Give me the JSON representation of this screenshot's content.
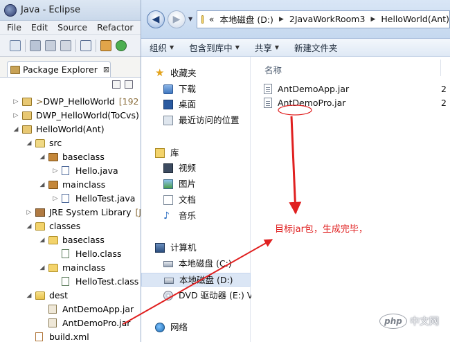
{
  "eclipse": {
    "title": "Java - Eclipse",
    "menu": [
      "File",
      "Edit",
      "Source",
      "Refactor"
    ],
    "view_tab": {
      "label": "Package Explorer",
      "close": "⊠"
    },
    "tree": [
      {
        "label": "DWP_HelloWorld",
        "prefix": ">",
        "suffix": "[192",
        "icon": "project",
        "twisty": "▷",
        "depth": 0
      },
      {
        "label": "DWP_HelloWorld(ToCvs)",
        "icon": "project",
        "twisty": "▷",
        "depth": 0
      },
      {
        "label": "HelloWorld(Ant)",
        "icon": "project",
        "twisty": "◢",
        "depth": 0
      },
      {
        "label": "src",
        "icon": "srcfolder",
        "twisty": "◢",
        "depth": 1
      },
      {
        "label": "baseclass",
        "icon": "package",
        "twisty": "◢",
        "depth": 2
      },
      {
        "label": "Hello.java",
        "icon": "java",
        "twisty": "▷",
        "depth": 3
      },
      {
        "label": "mainclass",
        "icon": "package",
        "twisty": "◢",
        "depth": 2
      },
      {
        "label": "HelloTest.java",
        "icon": "java",
        "twisty": "▷",
        "depth": 3
      },
      {
        "label": "JRE System Library",
        "suffix": "[J",
        "icon": "lib",
        "twisty": "▷",
        "depth": 1
      },
      {
        "label": "classes",
        "icon": "folder",
        "twisty": "◢",
        "depth": 1
      },
      {
        "label": "baseclass",
        "icon": "folder",
        "twisty": "◢",
        "depth": 2
      },
      {
        "label": "Hello.class",
        "icon": "class",
        "twisty": "",
        "depth": 3
      },
      {
        "label": "mainclass",
        "icon": "folder",
        "twisty": "◢",
        "depth": 2
      },
      {
        "label": "HelloTest.class",
        "icon": "class",
        "twisty": "",
        "depth": 3
      },
      {
        "label": "dest",
        "icon": "folder-open",
        "twisty": "◢",
        "depth": 1
      },
      {
        "label": "AntDemoApp.jar",
        "icon": "jar",
        "twisty": "",
        "depth": 2
      },
      {
        "label": "AntDemoPro.jar",
        "icon": "jar",
        "twisty": "",
        "depth": 2
      },
      {
        "label": "build.xml",
        "icon": "xml",
        "twisty": "",
        "depth": 1
      }
    ]
  },
  "explorer": {
    "address": [
      "«",
      "本地磁盘 (D:)",
      "2JavaWorkRoom3",
      "HelloWorld(Ant)"
    ],
    "commands": [
      {
        "label": "组织",
        "caret": true
      },
      {
        "label": "包含到库中",
        "caret": true
      },
      {
        "label": "共享",
        "caret": true
      },
      {
        "label": "新建文件夹",
        "caret": false
      }
    ],
    "nav": [
      {
        "label": "收藏夹",
        "icon": "star",
        "group": "favorites"
      },
      {
        "label": "下载",
        "icon": "download",
        "group": "favorites"
      },
      {
        "label": "桌面",
        "icon": "desktop",
        "group": "favorites"
      },
      {
        "label": "最近访问的位置",
        "icon": "recent",
        "group": "favorites"
      },
      {
        "label": "库",
        "icon": "lib",
        "group": "libraries"
      },
      {
        "label": "视频",
        "icon": "video",
        "group": "libraries"
      },
      {
        "label": "图片",
        "icon": "picture",
        "group": "libraries"
      },
      {
        "label": "文档",
        "icon": "doc",
        "group": "libraries"
      },
      {
        "label": "音乐",
        "icon": "music",
        "group": "libraries"
      },
      {
        "label": "计算机",
        "icon": "computer",
        "group": "computer"
      },
      {
        "label": "本地磁盘 (C:)",
        "icon": "disk",
        "group": "computer"
      },
      {
        "label": "本地磁盘 (D:)",
        "icon": "disk",
        "group": "computer",
        "selected": true
      },
      {
        "label": "DVD 驱动器 (E:) VM",
        "icon": "dvd",
        "group": "computer"
      },
      {
        "label": "网络",
        "icon": "network",
        "group": "network"
      }
    ],
    "column_header": "名称",
    "files": [
      {
        "name": "AntDemoApp.jar",
        "date": "2"
      },
      {
        "name": "AntDemoPro.jar",
        "date": "2"
      }
    ]
  },
  "annotation": "目标jar包，生成完毕，",
  "watermark": {
    "logo": "php",
    "text": "中文网"
  },
  "colors": {
    "annotation": "#e02020",
    "explorer_bar": "#c5d8ef",
    "selected": "#dbe6f5"
  }
}
